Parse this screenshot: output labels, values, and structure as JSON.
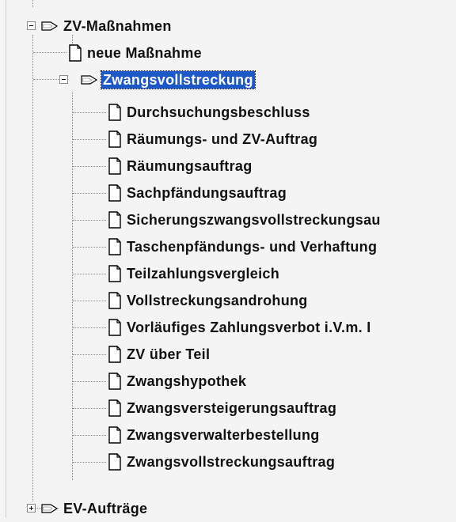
{
  "tree": {
    "root": {
      "label": "ZV-Maßnahmen",
      "expanded": true,
      "icon": "folder-arrow-icon"
    },
    "root_children": [
      {
        "label": "neue Maßnahme",
        "icon": "document-icon"
      }
    ],
    "selected_node": {
      "label": "Zwangsvollstreckung",
      "expanded": true,
      "icon": "folder-arrow-icon"
    },
    "items": [
      {
        "label": "Durchsuchungsbeschluss"
      },
      {
        "label": "Räumungs- und ZV-Auftrag"
      },
      {
        "label": "Räumungsauftrag"
      },
      {
        "label": "Sachpfändungsauftrag"
      },
      {
        "label": "Sicherungszwangsvollstreckungsau"
      },
      {
        "label": "Taschenpfändungs- und Verhaftung"
      },
      {
        "label": "Teilzahlungsvergleich"
      },
      {
        "label": "Vollstreckungsandrohung"
      },
      {
        "label": "Vorläufiges Zahlungsverbot i.V.m. I"
      },
      {
        "label": "ZV über Teil"
      },
      {
        "label": "Zwangshypothek"
      },
      {
        "label": "Zwangsversteigerungsauftrag"
      },
      {
        "label": "Zwangsverwalterbestellung"
      },
      {
        "label": "Zwangsvollstreckungsauftrag"
      }
    ],
    "next_node": {
      "label": "EV-Aufträge",
      "expanded": false,
      "icon": "folder-arrow-icon"
    },
    "colors": {
      "selection": "#1d58c8",
      "background": "#f4f4f4",
      "lines": "#8a8a8a"
    }
  }
}
